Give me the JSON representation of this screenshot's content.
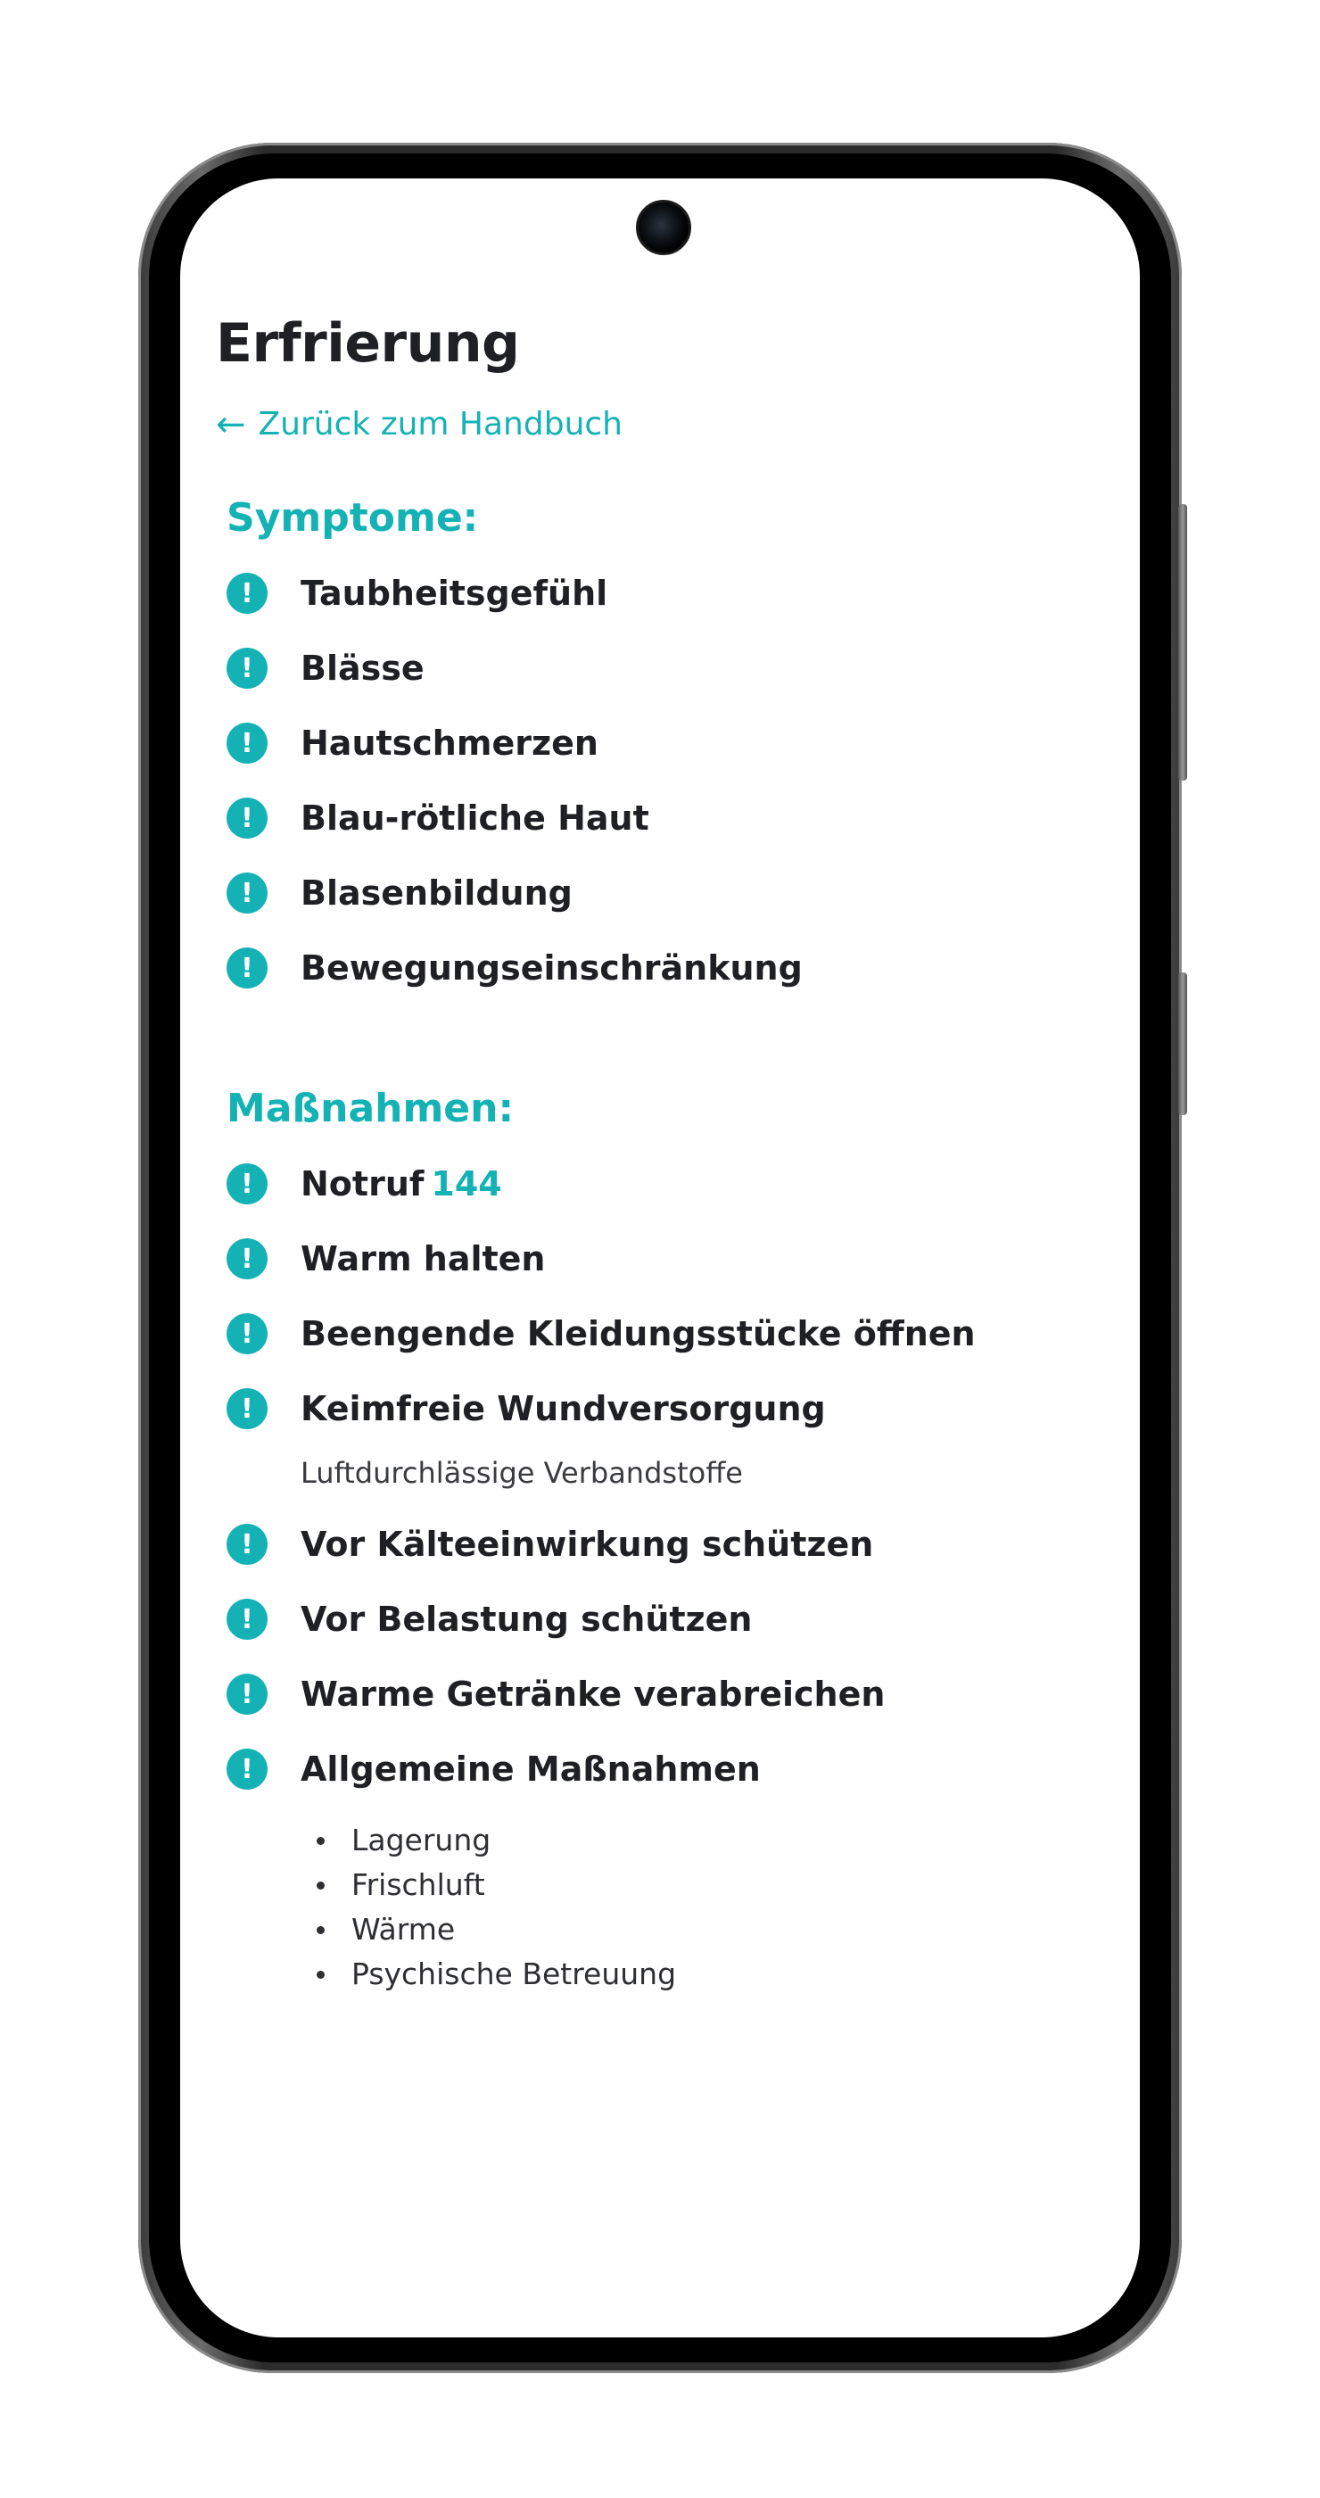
{
  "page": {
    "title": "Erfrierung",
    "back_link": "Zurück zum Handbuch"
  },
  "symptoms": {
    "heading": "Symptome:",
    "items": [
      "Taubheitsgefühl",
      "Blässe",
      "Hautschmerzen",
      "Blau-rötliche Haut",
      "Blasenbildung",
      "Bewegungseinschränkung"
    ]
  },
  "measures": {
    "heading": "Maßnahmen:",
    "items": [
      {
        "label": "Notruf",
        "accent": "144"
      },
      {
        "label": "Warm halten"
      },
      {
        "label": "Beengende Kleidungsstücke öffnen"
      },
      {
        "label": "Keimfreie Wundversorgung",
        "note": "Luftdurchlässige Verbandstoffe"
      },
      {
        "label": "Vor Kälteeinwirkung schützen"
      },
      {
        "label": "Vor Belastung schützen"
      },
      {
        "label": "Warme Getränke verabreichen"
      },
      {
        "label": "Allgemeine Maßnahmen"
      }
    ],
    "general_list": [
      "Lagerung",
      "Frischluft",
      "Wärme",
      "Psychische Betreuung"
    ]
  },
  "icons": {
    "item_marker": "exclamation-circle-icon",
    "back": "arrow-left-icon"
  },
  "colors": {
    "accent": "#14b2b5",
    "text": "#1f2024"
  }
}
